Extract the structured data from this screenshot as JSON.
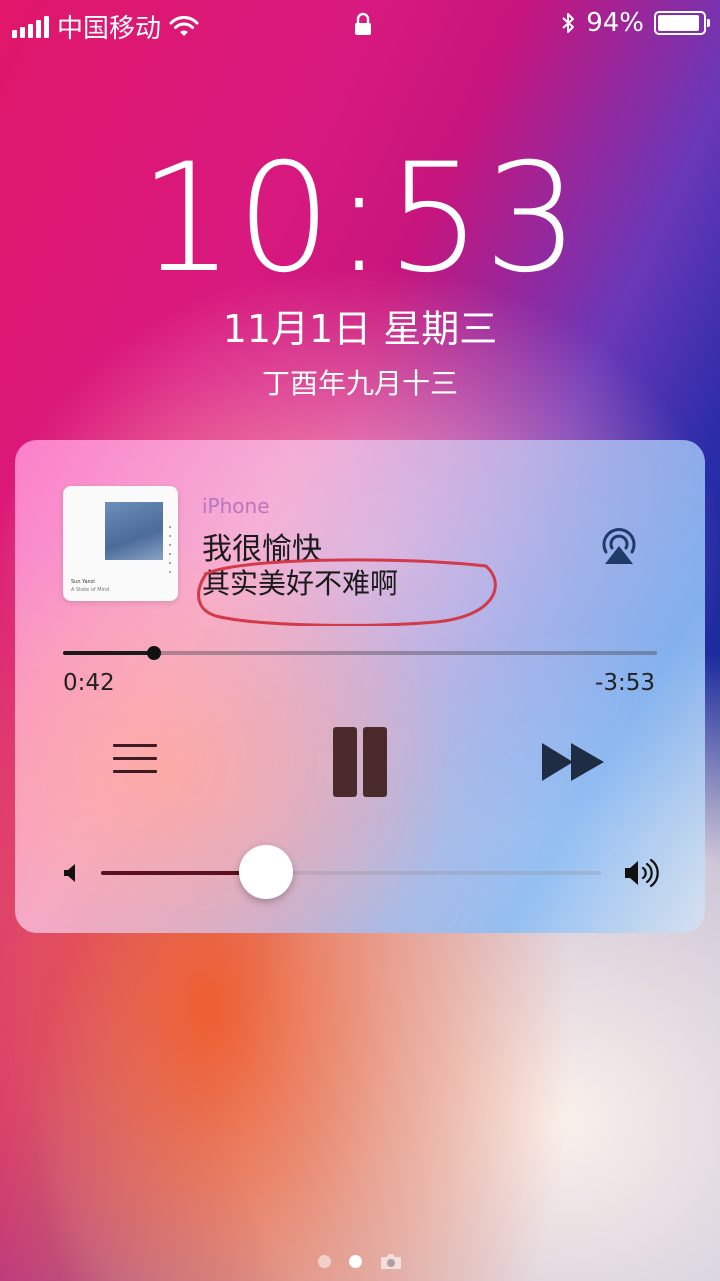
{
  "status_bar": {
    "carrier": "中国移动",
    "battery": "94%",
    "battery_level": 0.94,
    "icons": [
      "signal-icon",
      "wifi-icon",
      "lock-icon",
      "bluetooth-icon",
      "battery-icon"
    ]
  },
  "lockscreen": {
    "time": "10:53",
    "date": "11月1日 星期三",
    "lunar_date": "丁酉年九月十三"
  },
  "now_playing": {
    "source": "iPhone",
    "song": "我很愉快",
    "artist": "其实美好不难啊",
    "album_text_1": "Sun Yanzi",
    "album_text_2": "A State of Mind",
    "elapsed": "0:42",
    "remaining": "-3:53",
    "progress": 0.153,
    "volume": 0.33,
    "accent_color": "#d23a4a",
    "icons": [
      "airplay-icon",
      "menu-icon",
      "pause-icon",
      "fast-forward-icon",
      "volume-min-icon",
      "volume-max-icon"
    ]
  },
  "page_indicator": {
    "count": 2,
    "active": 1,
    "camera_icon": "camera-icon"
  }
}
